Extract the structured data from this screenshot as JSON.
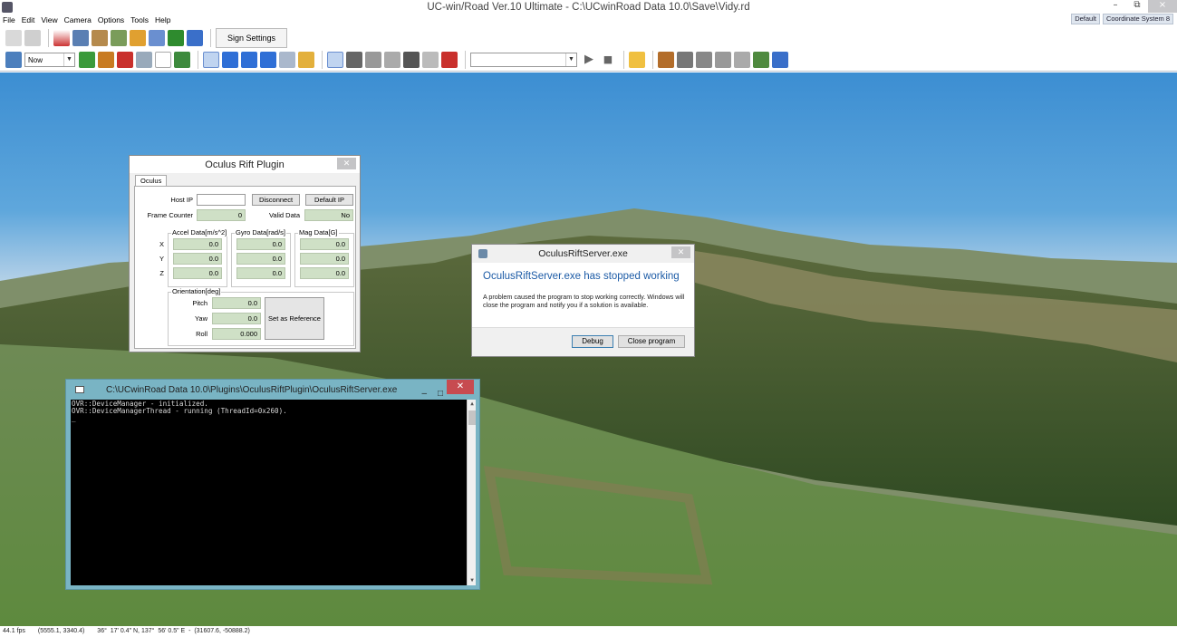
{
  "window": {
    "title": "UC-win/Road Ver.10 Ultimate - C:\\UCwinRoad Data 10.0\\Save\\Vidy.rd",
    "min": "–",
    "restore": "⧉",
    "close": "×"
  },
  "menu": [
    "File",
    "Edit",
    "View",
    "Camera",
    "Options",
    "Tools",
    "Help"
  ],
  "corner": {
    "default_btn": "Default",
    "coord_btn": "Coordinate System 8"
  },
  "toolbar": {
    "sign_settings": "Sign Settings",
    "time_combo": "Now",
    "scenario_combo": "",
    "colors": {
      "accent": "#3a6fc9",
      "red": "#c9302c",
      "green": "#2e8b2e"
    }
  },
  "oculus_plugin": {
    "title": "Oculus Rift Plugin",
    "tab": "Oculus",
    "host_ip_label": "Host IP",
    "host_ip_value": "",
    "disconnect": "Disconnect",
    "default_ip": "Default IP",
    "frame_counter_label": "Frame Counter",
    "frame_counter_value": "0",
    "valid_data_label": "Valid Data",
    "valid_data_value": "No",
    "accel_label": "Accel Data[m/s^2]",
    "gyro_label": "Gyro Data[rad/s]",
    "mag_label": "Mag Data[G]",
    "axes": [
      "X",
      "Y",
      "Z"
    ],
    "accel": [
      "0.0",
      "0.0",
      "0.0"
    ],
    "gyro": [
      "0.0",
      "0.0",
      "0.0"
    ],
    "mag": [
      "0.0",
      "0.0",
      "0.0"
    ],
    "orientation_label": "Orientation[deg]",
    "pitch_label": "Pitch",
    "pitch": "0.0",
    "yaw_label": "Yaw",
    "yaw": "0.0",
    "roll_label": "Roll",
    "roll": "0.000",
    "set_reference": "Set as Reference"
  },
  "error_dialog": {
    "title": "OculusRiftServer.exe",
    "heading": "OculusRiftServer.exe has stopped working",
    "body": "A problem caused the program to stop working correctly. Windows will close the program and notify you if a solution is available.",
    "debug": "Debug",
    "close_program": "Close program"
  },
  "console": {
    "title": "C:\\UCwinRoad Data 10.0\\Plugins\\OculusRiftPlugin\\OculusRiftServer.exe",
    "lines": [
      "OVR::DeviceManager - initialized.",
      "OVR::DeviceManagerThread - running (ThreadId=0x260).",
      "_"
    ]
  },
  "status": {
    "fps": "44.1 fps",
    "screen_coords": "(5555.1, 3340.4)",
    "geo": "36°  17' 0.4\" N, 137°  56' 0.5\" E  -  (31607.6, -50888.2)"
  }
}
